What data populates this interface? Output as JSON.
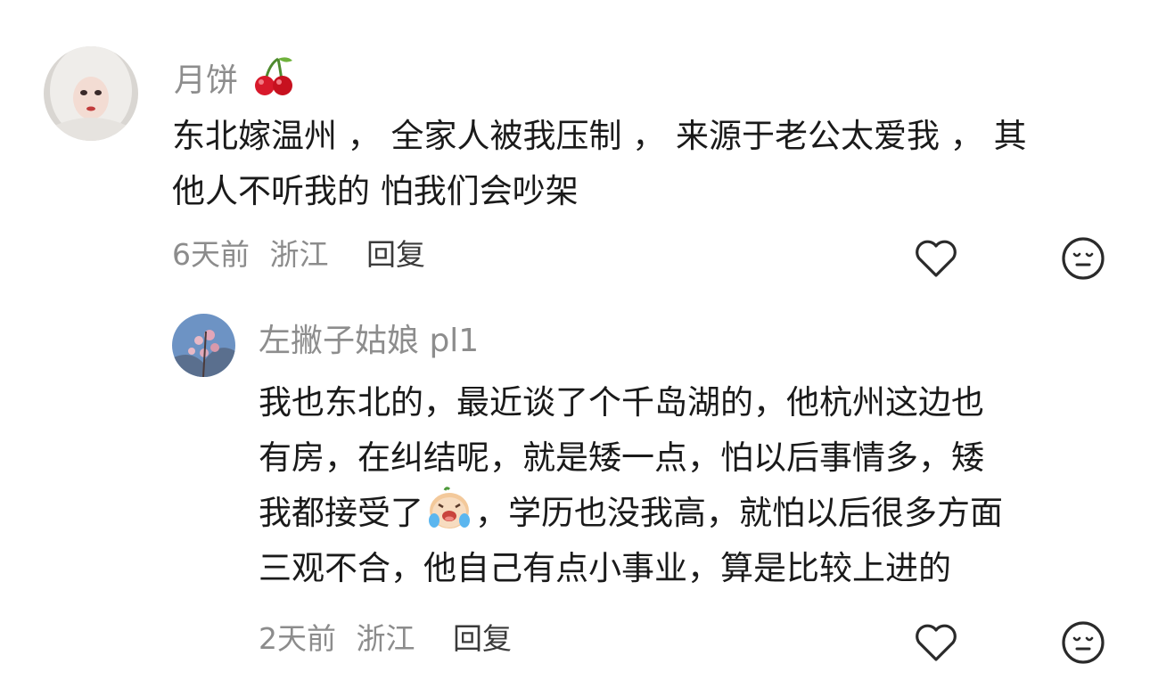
{
  "comment": {
    "username": "月饼",
    "username_emoji": "cherries",
    "content_lines": [
      "东北嫁温州 ， 全家人被我压制 ， 来源于老公太爱我 ， 其",
      "他人不听我的 怕我们会吵架"
    ],
    "time": "6天前",
    "location": "浙江",
    "reply_label": "回复"
  },
  "reply": {
    "username": "左撇子姑娘 pl1",
    "content_lines": [
      "我也东北的，最近谈了个千岛湖的，他杭州这边也",
      "有房，在纠结呢，就是矮一点，怕以后事情多，矮",
      "我都接受了",
      "，学历也没我高，就怕以后很多方面",
      "三观不合，他自己有点小事业，算是比较上进的"
    ],
    "inline_emoji": "crying-sticker",
    "time": "2天前",
    "location": "浙江",
    "reply_label": "回复"
  },
  "colors": {
    "meta_text": "#8c8c8c",
    "content_text": "#1a1a1a",
    "cherry_red": "#d8192b",
    "heart_stroke": "#2a2a2a"
  },
  "icons": [
    "heart-like-icon",
    "unhappy-face-icon"
  ]
}
